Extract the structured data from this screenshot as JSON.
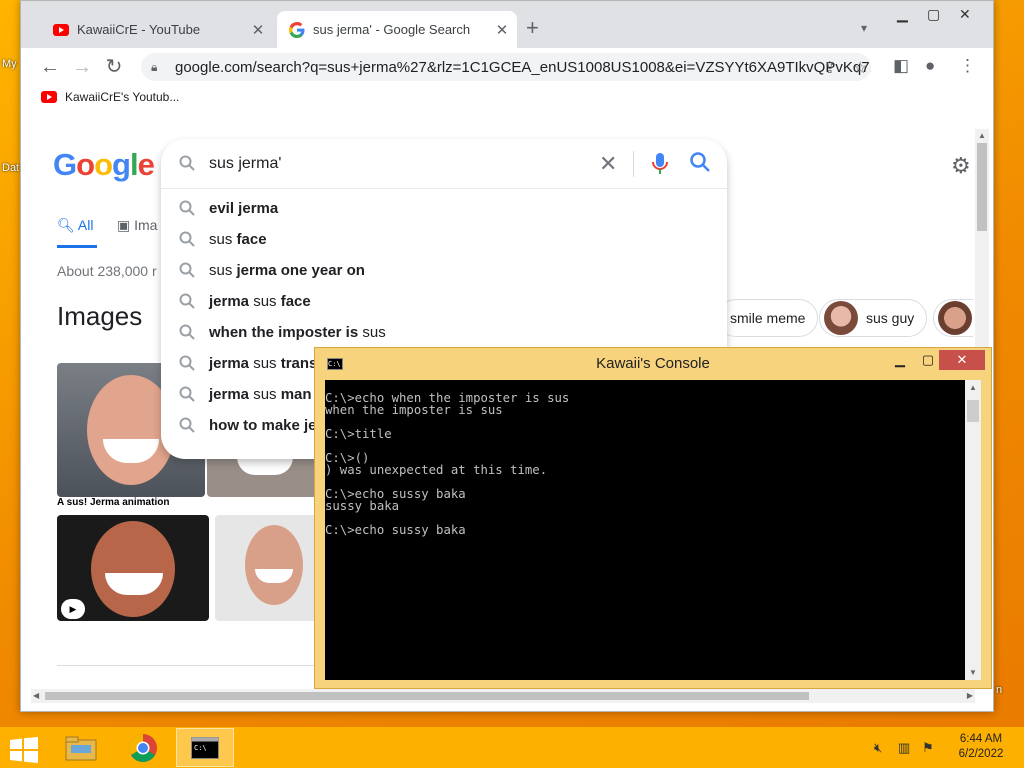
{
  "desktop": {
    "left_labels": [
      "My",
      "Dat"
    ],
    "right_label": "n"
  },
  "browser": {
    "tabs": [
      {
        "title": "KawaiiCrE - YouTube",
        "icon": "youtube-icon",
        "active": false
      },
      {
        "title": "sus jerma' - Google Search",
        "icon": "google-icon",
        "active": true
      }
    ],
    "new_tab_label": "+",
    "url": "google.com/search?q=sus+jerma%27&rlz=1C1GCEA_enUS1008US1008&ei=VZSYYt6XA9TIkvQPvKq7...",
    "bookmarks": [
      {
        "label": "KawaiiCrE's Youtub..."
      }
    ]
  },
  "google": {
    "logo": "Google",
    "query": "sus jerma'",
    "suggestions": [
      {
        "parts": [
          {
            "t": "evil jerma",
            "b": true
          }
        ]
      },
      {
        "parts": [
          {
            "t": "sus ",
            "b": false
          },
          {
            "t": "face",
            "b": true
          }
        ]
      },
      {
        "parts": [
          {
            "t": "sus ",
            "b": false
          },
          {
            "t": "jerma one year on",
            "b": true
          }
        ]
      },
      {
        "parts": [
          {
            "t": "jerma",
            "b": true
          },
          {
            "t": " sus ",
            "b": false
          },
          {
            "t": "face",
            "b": true
          }
        ]
      },
      {
        "parts": [
          {
            "t": "when the imposter is",
            "b": true
          },
          {
            "t": " sus",
            "b": false
          }
        ]
      },
      {
        "parts": [
          {
            "t": "jerma",
            "b": true
          },
          {
            "t": " sus ",
            "b": false
          },
          {
            "t": "trans",
            "b": true
          }
        ]
      },
      {
        "parts": [
          {
            "t": "jerma",
            "b": true
          },
          {
            "t": " sus ",
            "b": false
          },
          {
            "t": "man",
            "b": true
          }
        ]
      },
      {
        "parts": [
          {
            "t": "how to make je",
            "b": true
          }
        ]
      }
    ],
    "tab_all": "All",
    "tab_images": "Ima",
    "result_stats": "About 238,000 r",
    "images_heading": "Images",
    "chips": [
      "smile meme",
      "sus guy"
    ],
    "image_caption": "A sus! Jerma animation"
  },
  "console": {
    "title": "Kawaii's Console",
    "lines": [
      "C:\\>echo when the imposter is sus",
      "when the imposter is sus",
      "",
      "C:\\>title",
      "",
      "C:\\>()",
      ") was unexpected at this time.",
      "",
      "C:\\>echo sussy baka",
      "sussy baka",
      "",
      "C:\\>echo sussy baka"
    ]
  },
  "taskbar": {
    "time": "6:44 AM",
    "date": "6/2/2022"
  },
  "colors": {
    "google_blue": "#4285F4",
    "google_red": "#EA4335",
    "google_yellow": "#FBBC05",
    "google_green": "#34A853",
    "youtube_red": "#FF0000",
    "console_frame": "#f8d37e",
    "close_red": "#c7504b"
  }
}
